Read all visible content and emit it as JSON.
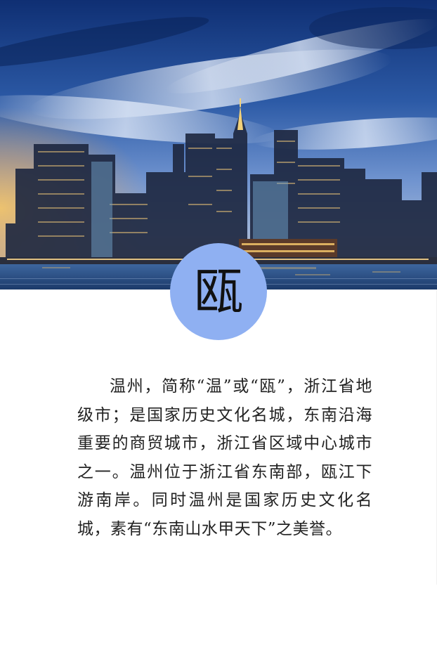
{
  "badge": {
    "character": "瓯",
    "color": "#8fb0f2"
  },
  "hero": {
    "description_icon": "city-skyline-image",
    "sky_color": "#2c5aa6",
    "water_color": "#2a4f86"
  },
  "intro": {
    "text": "温州，简称“温”或“瓯”，浙江省地级市；是国家历史文化名城，东南沿海重要的商贸城市，浙江省区域中心城市之一。温州位于浙江省东南部，瓯江下游南岸。同时温州是国家历史文化名城，素有“东南山水甲天下”之美誉。"
  }
}
